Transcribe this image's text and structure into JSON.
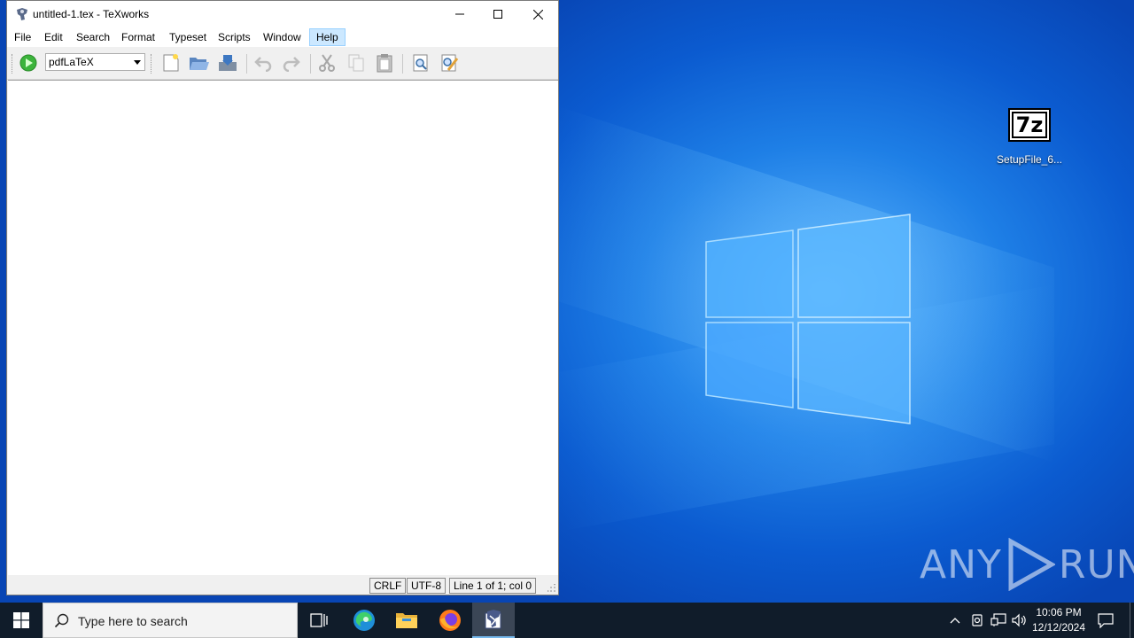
{
  "window": {
    "title": "untitled-1.tex - TeXworks",
    "menus": [
      "File",
      "Edit",
      "Search",
      "Format",
      "Typeset",
      "Scripts",
      "Window",
      "Help"
    ],
    "highlighted_menu": "Help",
    "toolbar": {
      "engine": "pdfLaTeX",
      "buttons": [
        "typeset-icon",
        "new-document-icon",
        "open-folder-icon",
        "save-icon",
        "undo-icon",
        "redo-icon",
        "cut-icon",
        "copy-icon",
        "paste-icon",
        "find-icon",
        "replace-icon"
      ]
    },
    "status": {
      "line_ending": "CRLF",
      "encoding": "UTF-8",
      "position": "Line 1 of 1; col 0"
    }
  },
  "desktop": {
    "icons": [
      {
        "label": "SetupFile_6...",
        "icon": "7z-archive-icon",
        "glyph": "7z"
      }
    ],
    "watermark": "ANY RUN"
  },
  "taskbar": {
    "search_placeholder": "Type here to search",
    "pinned": [
      "task-view-icon",
      "edge-icon",
      "file-explorer-icon",
      "firefox-icon",
      "texworks-icon"
    ],
    "active_app": "texworks-icon",
    "clock": {
      "time": "10:06 PM",
      "date": "12/12/2024"
    }
  },
  "colors": {
    "desktop_blue": "#0b5bd0",
    "taskbar": "#101c2a",
    "menu_highlight": "#cce8ff"
  }
}
